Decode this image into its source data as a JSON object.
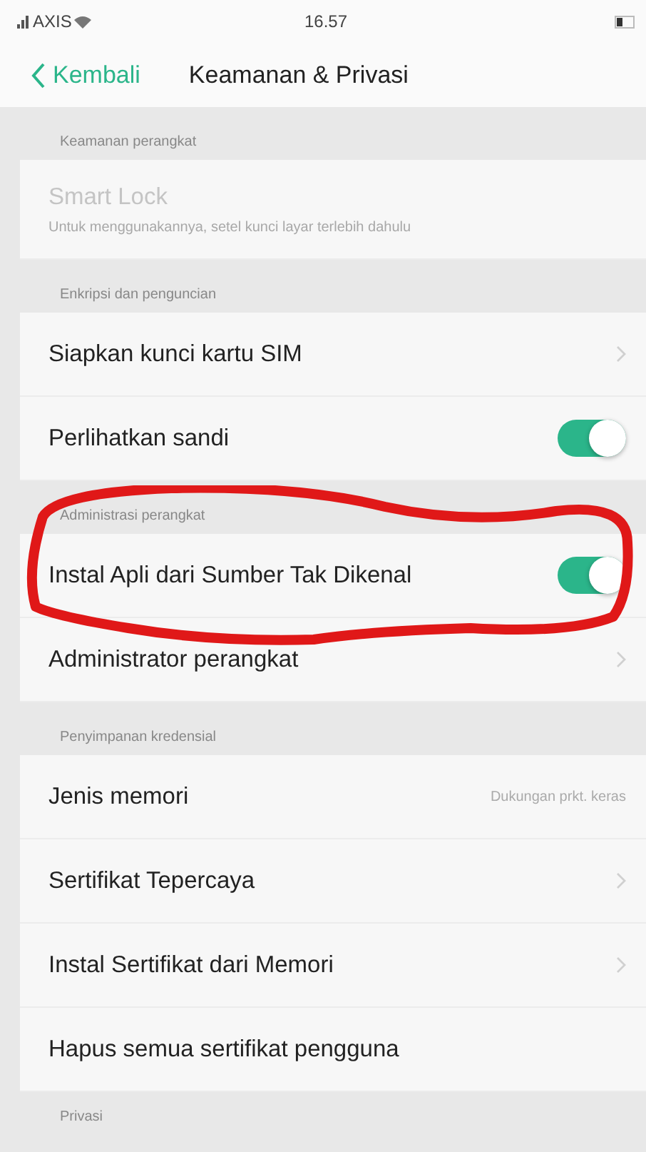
{
  "status_bar": {
    "carrier": "AXIS",
    "time": "16.57"
  },
  "nav": {
    "back": "Kembali",
    "title": "Keamanan & Privasi"
  },
  "sections": [
    {
      "header": "Keamanan perangkat",
      "items": [
        {
          "kind": "info",
          "label": "Smart Lock",
          "subtitle": "Untuk menggunakannya, setel kunci layar terlebih dahulu",
          "disabled": true
        }
      ]
    },
    {
      "header": "Enkripsi dan penguncian",
      "items": [
        {
          "kind": "link",
          "label": "Siapkan kunci kartu SIM"
        },
        {
          "kind": "toggle",
          "label": "Perlihatkan sandi",
          "on": true
        }
      ]
    },
    {
      "header": "Administrasi perangkat",
      "items": [
        {
          "kind": "toggle",
          "label": "Instal Apli dari Sumber Tak Dikenal",
          "on": true
        },
        {
          "kind": "link",
          "label": "Administrator perangkat"
        }
      ]
    },
    {
      "header": "Penyimpanan kredensial",
      "items": [
        {
          "kind": "value",
          "label": "Jenis memori",
          "value": "Dukungan prkt. keras"
        },
        {
          "kind": "link",
          "label": "Sertifikat Tepercaya"
        },
        {
          "kind": "link",
          "label": "Instal Sertifikat dari Memori"
        },
        {
          "kind": "plain",
          "label": "Hapus semua sertifikat pengguna"
        }
      ]
    },
    {
      "header": "Privasi"
    }
  ]
}
